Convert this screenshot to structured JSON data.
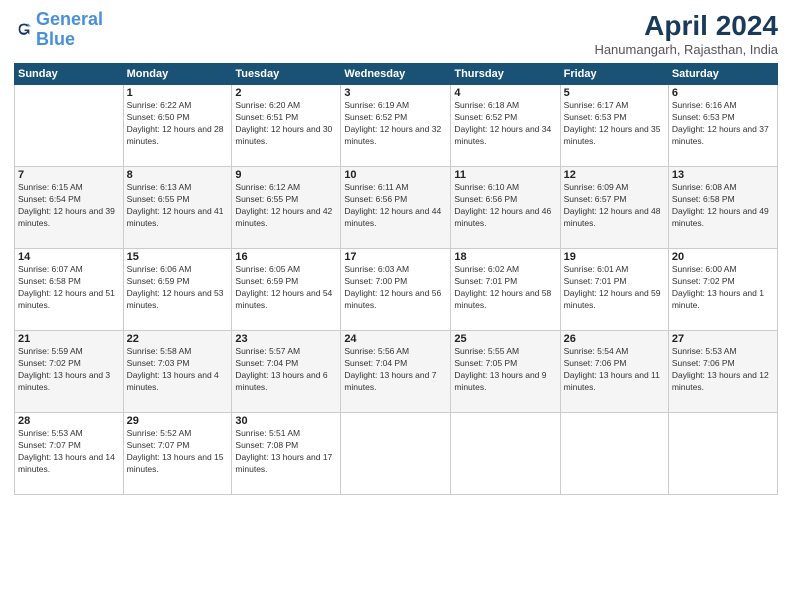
{
  "logo": {
    "line1": "General",
    "line2": "Blue"
  },
  "title": "April 2024",
  "subtitle": "Hanumangarh, Rajasthan, India",
  "days_header": [
    "Sunday",
    "Monday",
    "Tuesday",
    "Wednesday",
    "Thursday",
    "Friday",
    "Saturday"
  ],
  "weeks": [
    [
      {
        "day": "",
        "sunrise": "",
        "sunset": "",
        "daylight": ""
      },
      {
        "day": "1",
        "sunrise": "Sunrise: 6:22 AM",
        "sunset": "Sunset: 6:50 PM",
        "daylight": "Daylight: 12 hours and 28 minutes."
      },
      {
        "day": "2",
        "sunrise": "Sunrise: 6:20 AM",
        "sunset": "Sunset: 6:51 PM",
        "daylight": "Daylight: 12 hours and 30 minutes."
      },
      {
        "day": "3",
        "sunrise": "Sunrise: 6:19 AM",
        "sunset": "Sunset: 6:52 PM",
        "daylight": "Daylight: 12 hours and 32 minutes."
      },
      {
        "day": "4",
        "sunrise": "Sunrise: 6:18 AM",
        "sunset": "Sunset: 6:52 PM",
        "daylight": "Daylight: 12 hours and 34 minutes."
      },
      {
        "day": "5",
        "sunrise": "Sunrise: 6:17 AM",
        "sunset": "Sunset: 6:53 PM",
        "daylight": "Daylight: 12 hours and 35 minutes."
      },
      {
        "day": "6",
        "sunrise": "Sunrise: 6:16 AM",
        "sunset": "Sunset: 6:53 PM",
        "daylight": "Daylight: 12 hours and 37 minutes."
      }
    ],
    [
      {
        "day": "7",
        "sunrise": "Sunrise: 6:15 AM",
        "sunset": "Sunset: 6:54 PM",
        "daylight": "Daylight: 12 hours and 39 minutes."
      },
      {
        "day": "8",
        "sunrise": "Sunrise: 6:13 AM",
        "sunset": "Sunset: 6:55 PM",
        "daylight": "Daylight: 12 hours and 41 minutes."
      },
      {
        "day": "9",
        "sunrise": "Sunrise: 6:12 AM",
        "sunset": "Sunset: 6:55 PM",
        "daylight": "Daylight: 12 hours and 42 minutes."
      },
      {
        "day": "10",
        "sunrise": "Sunrise: 6:11 AM",
        "sunset": "Sunset: 6:56 PM",
        "daylight": "Daylight: 12 hours and 44 minutes."
      },
      {
        "day": "11",
        "sunrise": "Sunrise: 6:10 AM",
        "sunset": "Sunset: 6:56 PM",
        "daylight": "Daylight: 12 hours and 46 minutes."
      },
      {
        "day": "12",
        "sunrise": "Sunrise: 6:09 AM",
        "sunset": "Sunset: 6:57 PM",
        "daylight": "Daylight: 12 hours and 48 minutes."
      },
      {
        "day": "13",
        "sunrise": "Sunrise: 6:08 AM",
        "sunset": "Sunset: 6:58 PM",
        "daylight": "Daylight: 12 hours and 49 minutes."
      }
    ],
    [
      {
        "day": "14",
        "sunrise": "Sunrise: 6:07 AM",
        "sunset": "Sunset: 6:58 PM",
        "daylight": "Daylight: 12 hours and 51 minutes."
      },
      {
        "day": "15",
        "sunrise": "Sunrise: 6:06 AM",
        "sunset": "Sunset: 6:59 PM",
        "daylight": "Daylight: 12 hours and 53 minutes."
      },
      {
        "day": "16",
        "sunrise": "Sunrise: 6:05 AM",
        "sunset": "Sunset: 6:59 PM",
        "daylight": "Daylight: 12 hours and 54 minutes."
      },
      {
        "day": "17",
        "sunrise": "Sunrise: 6:03 AM",
        "sunset": "Sunset: 7:00 PM",
        "daylight": "Daylight: 12 hours and 56 minutes."
      },
      {
        "day": "18",
        "sunrise": "Sunrise: 6:02 AM",
        "sunset": "Sunset: 7:01 PM",
        "daylight": "Daylight: 12 hours and 58 minutes."
      },
      {
        "day": "19",
        "sunrise": "Sunrise: 6:01 AM",
        "sunset": "Sunset: 7:01 PM",
        "daylight": "Daylight: 12 hours and 59 minutes."
      },
      {
        "day": "20",
        "sunrise": "Sunrise: 6:00 AM",
        "sunset": "Sunset: 7:02 PM",
        "daylight": "Daylight: 13 hours and 1 minute."
      }
    ],
    [
      {
        "day": "21",
        "sunrise": "Sunrise: 5:59 AM",
        "sunset": "Sunset: 7:02 PM",
        "daylight": "Daylight: 13 hours and 3 minutes."
      },
      {
        "day": "22",
        "sunrise": "Sunrise: 5:58 AM",
        "sunset": "Sunset: 7:03 PM",
        "daylight": "Daylight: 13 hours and 4 minutes."
      },
      {
        "day": "23",
        "sunrise": "Sunrise: 5:57 AM",
        "sunset": "Sunset: 7:04 PM",
        "daylight": "Daylight: 13 hours and 6 minutes."
      },
      {
        "day": "24",
        "sunrise": "Sunrise: 5:56 AM",
        "sunset": "Sunset: 7:04 PM",
        "daylight": "Daylight: 13 hours and 7 minutes."
      },
      {
        "day": "25",
        "sunrise": "Sunrise: 5:55 AM",
        "sunset": "Sunset: 7:05 PM",
        "daylight": "Daylight: 13 hours and 9 minutes."
      },
      {
        "day": "26",
        "sunrise": "Sunrise: 5:54 AM",
        "sunset": "Sunset: 7:06 PM",
        "daylight": "Daylight: 13 hours and 11 minutes."
      },
      {
        "day": "27",
        "sunrise": "Sunrise: 5:53 AM",
        "sunset": "Sunset: 7:06 PM",
        "daylight": "Daylight: 13 hours and 12 minutes."
      }
    ],
    [
      {
        "day": "28",
        "sunrise": "Sunrise: 5:53 AM",
        "sunset": "Sunset: 7:07 PM",
        "daylight": "Daylight: 13 hours and 14 minutes."
      },
      {
        "day": "29",
        "sunrise": "Sunrise: 5:52 AM",
        "sunset": "Sunset: 7:07 PM",
        "daylight": "Daylight: 13 hours and 15 minutes."
      },
      {
        "day": "30",
        "sunrise": "Sunrise: 5:51 AM",
        "sunset": "Sunset: 7:08 PM",
        "daylight": "Daylight: 13 hours and 17 minutes."
      },
      {
        "day": "",
        "sunrise": "",
        "sunset": "",
        "daylight": ""
      },
      {
        "day": "",
        "sunrise": "",
        "sunset": "",
        "daylight": ""
      },
      {
        "day": "",
        "sunrise": "",
        "sunset": "",
        "daylight": ""
      },
      {
        "day": "",
        "sunrise": "",
        "sunset": "",
        "daylight": ""
      }
    ]
  ]
}
